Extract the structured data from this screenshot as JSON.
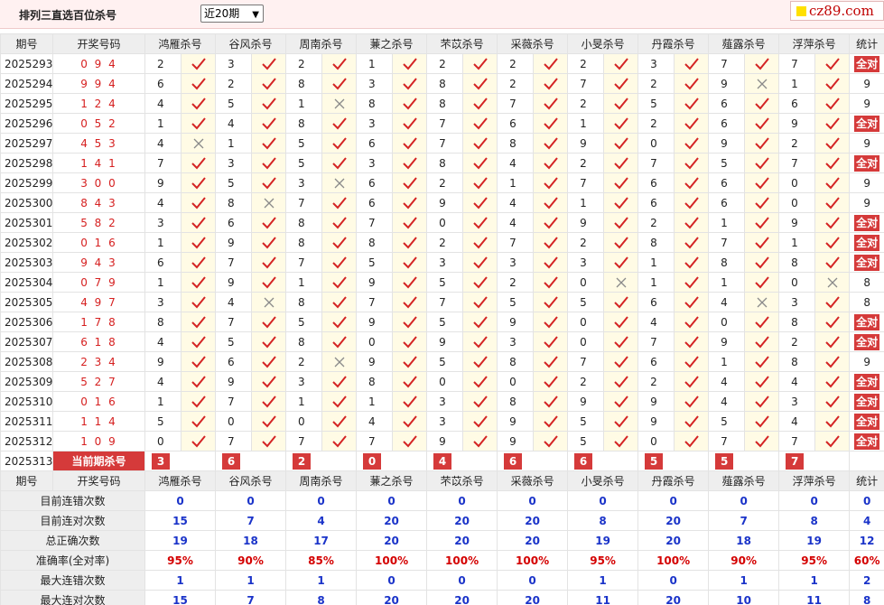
{
  "header": {
    "title": "排列三直选百位杀号",
    "range_select": "近20期",
    "logo": "cz89.com"
  },
  "columns": {
    "period": "期号",
    "numbers": "开奖号码",
    "stats": "统计",
    "experts": [
      "鸿雁杀号",
      "谷风杀号",
      "周南杀号",
      "蒹之杀号",
      "芣苡杀号",
      "采薇杀号",
      "小旻杀号",
      "丹霞杀号",
      "薤露杀号",
      "浮萍杀号"
    ]
  },
  "rows": [
    {
      "period": "2025293",
      "numbers": "0 9 4",
      "kills": [
        2,
        3,
        2,
        1,
        2,
        2,
        2,
        3,
        7,
        7
      ],
      "hits": [
        1,
        1,
        1,
        1,
        1,
        1,
        1,
        1,
        1,
        1
      ],
      "total": "全对"
    },
    {
      "period": "2025294",
      "numbers": "9 9 4",
      "kills": [
        6,
        2,
        8,
        3,
        8,
        2,
        7,
        2,
        9,
        1
      ],
      "hits": [
        1,
        1,
        1,
        1,
        1,
        1,
        1,
        1,
        0,
        1
      ],
      "total": "9"
    },
    {
      "period": "2025295",
      "numbers": "1 2 4",
      "kills": [
        4,
        5,
        1,
        8,
        8,
        7,
        2,
        5,
        6,
        6
      ],
      "hits": [
        1,
        1,
        0,
        1,
        1,
        1,
        1,
        1,
        1,
        1
      ],
      "total": "9"
    },
    {
      "period": "2025296",
      "numbers": "0 5 2",
      "kills": [
        1,
        4,
        8,
        3,
        7,
        6,
        1,
        2,
        6,
        9
      ],
      "hits": [
        1,
        1,
        1,
        1,
        1,
        1,
        1,
        1,
        1,
        1
      ],
      "total": "全对"
    },
    {
      "period": "2025297",
      "numbers": "4 5 3",
      "kills": [
        4,
        1,
        5,
        6,
        7,
        8,
        9,
        0,
        9,
        2
      ],
      "hits": [
        0,
        1,
        1,
        1,
        1,
        1,
        1,
        1,
        1,
        1
      ],
      "total": "9"
    },
    {
      "period": "2025298",
      "numbers": "1 4 1",
      "kills": [
        7,
        3,
        5,
        3,
        8,
        4,
        2,
        7,
        5,
        7
      ],
      "hits": [
        1,
        1,
        1,
        1,
        1,
        1,
        1,
        1,
        1,
        1
      ],
      "total": "全对"
    },
    {
      "period": "2025299",
      "numbers": "3 0 0",
      "kills": [
        9,
        5,
        3,
        6,
        2,
        1,
        7,
        6,
        6,
        0
      ],
      "hits": [
        1,
        1,
        0,
        1,
        1,
        1,
        1,
        1,
        1,
        1
      ],
      "total": "9"
    },
    {
      "period": "2025300",
      "numbers": "8 4 3",
      "kills": [
        4,
        8,
        7,
        6,
        9,
        4,
        1,
        6,
        6,
        0
      ],
      "hits": [
        1,
        0,
        1,
        1,
        1,
        1,
        1,
        1,
        1,
        1
      ],
      "total": "9"
    },
    {
      "period": "2025301",
      "numbers": "5 8 2",
      "kills": [
        3,
        6,
        8,
        7,
        0,
        4,
        9,
        2,
        1,
        9
      ],
      "hits": [
        1,
        1,
        1,
        1,
        1,
        1,
        1,
        1,
        1,
        1
      ],
      "total": "全对"
    },
    {
      "period": "2025302",
      "numbers": "0 1 6",
      "kills": [
        1,
        9,
        8,
        8,
        2,
        7,
        2,
        8,
        7,
        1
      ],
      "hits": [
        1,
        1,
        1,
        1,
        1,
        1,
        1,
        1,
        1,
        1
      ],
      "total": "全对"
    },
    {
      "period": "2025303",
      "numbers": "9 4 3",
      "kills": [
        6,
        7,
        7,
        5,
        3,
        3,
        3,
        1,
        8,
        8
      ],
      "hits": [
        1,
        1,
        1,
        1,
        1,
        1,
        1,
        1,
        1,
        1
      ],
      "total": "全对"
    },
    {
      "period": "2025304",
      "numbers": "0 7 9",
      "kills": [
        1,
        9,
        1,
        9,
        5,
        2,
        0,
        1,
        1,
        0
      ],
      "hits": [
        1,
        1,
        1,
        1,
        1,
        1,
        0,
        1,
        1,
        0
      ],
      "total": "8"
    },
    {
      "period": "2025305",
      "numbers": "4 9 7",
      "kills": [
        3,
        4,
        8,
        7,
        7,
        5,
        5,
        6,
        4,
        3
      ],
      "hits": [
        1,
        0,
        1,
        1,
        1,
        1,
        1,
        1,
        0,
        1
      ],
      "total": "8"
    },
    {
      "period": "2025306",
      "numbers": "1 7 8",
      "kills": [
        8,
        7,
        5,
        9,
        5,
        9,
        0,
        4,
        0,
        8
      ],
      "hits": [
        1,
        1,
        1,
        1,
        1,
        1,
        1,
        1,
        1,
        1
      ],
      "total": "全对"
    },
    {
      "period": "2025307",
      "numbers": "6 1 8",
      "kills": [
        4,
        5,
        8,
        0,
        9,
        3,
        0,
        7,
        9,
        2
      ],
      "hits": [
        1,
        1,
        1,
        1,
        1,
        1,
        1,
        1,
        1,
        1
      ],
      "total": "全对"
    },
    {
      "period": "2025308",
      "numbers": "2 3 4",
      "kills": [
        9,
        6,
        2,
        9,
        5,
        8,
        7,
        6,
        1,
        8
      ],
      "hits": [
        1,
        1,
        0,
        1,
        1,
        1,
        1,
        1,
        1,
        1
      ],
      "total": "9"
    },
    {
      "period": "2025309",
      "numbers": "5 2 7",
      "kills": [
        4,
        9,
        3,
        8,
        0,
        0,
        2,
        2,
        4,
        4
      ],
      "hits": [
        1,
        1,
        1,
        1,
        1,
        1,
        1,
        1,
        1,
        1
      ],
      "total": "全对"
    },
    {
      "period": "2025310",
      "numbers": "0 1 6",
      "kills": [
        1,
        7,
        1,
        1,
        3,
        8,
        9,
        9,
        4,
        3
      ],
      "hits": [
        1,
        1,
        1,
        1,
        1,
        1,
        1,
        1,
        1,
        1
      ],
      "total": "全对"
    },
    {
      "period": "2025311",
      "numbers": "1 1 4",
      "kills": [
        5,
        0,
        0,
        4,
        3,
        9,
        5,
        9,
        5,
        4
      ],
      "hits": [
        1,
        1,
        1,
        1,
        1,
        1,
        1,
        1,
        1,
        1
      ],
      "total": "全对"
    },
    {
      "period": "2025312",
      "numbers": "1 0 9",
      "kills": [
        0,
        7,
        7,
        7,
        9,
        9,
        5,
        0,
        7,
        7
      ],
      "hits": [
        1,
        1,
        1,
        1,
        1,
        1,
        1,
        1,
        1,
        1
      ],
      "total": "全对"
    }
  ],
  "current": {
    "period": "2025313",
    "label": "当前期杀号",
    "kills": [
      "3",
      "6",
      "2",
      "0",
      "4",
      "6",
      "6",
      "5",
      "5",
      "7"
    ]
  },
  "stats": [
    {
      "label": "目前连错次数",
      "values": [
        "0",
        "0",
        "0",
        "0",
        "0",
        "0",
        "0",
        "0",
        "0",
        "0"
      ],
      "total": "0"
    },
    {
      "label": "目前连对次数",
      "values": [
        "15",
        "7",
        "4",
        "20",
        "20",
        "20",
        "8",
        "20",
        "7",
        "8"
      ],
      "total": "4"
    },
    {
      "label": "总正确次数",
      "values": [
        "19",
        "18",
        "17",
        "20",
        "20",
        "20",
        "19",
        "20",
        "18",
        "19"
      ],
      "total": "12"
    },
    {
      "label": "准确率(全对率)",
      "values": [
        "95%",
        "90%",
        "85%",
        "100%",
        "100%",
        "100%",
        "95%",
        "100%",
        "90%",
        "95%"
      ],
      "total": "60%"
    },
    {
      "label": "最大连错次数",
      "values": [
        "1",
        "1",
        "1",
        "0",
        "0",
        "0",
        "1",
        "0",
        "1",
        "1"
      ],
      "total": "2"
    },
    {
      "label": "最大连对次数",
      "values": [
        "15",
        "7",
        "8",
        "20",
        "20",
        "20",
        "11",
        "20",
        "10",
        "11"
      ],
      "total": "8"
    }
  ],
  "colors": {
    "accent_red": "#d53a3a",
    "check_red": "#d42424",
    "cross_gray": "#8a8a8a",
    "stat_blue": "#1a33c9",
    "mark_bg": "#fffbe5"
  }
}
